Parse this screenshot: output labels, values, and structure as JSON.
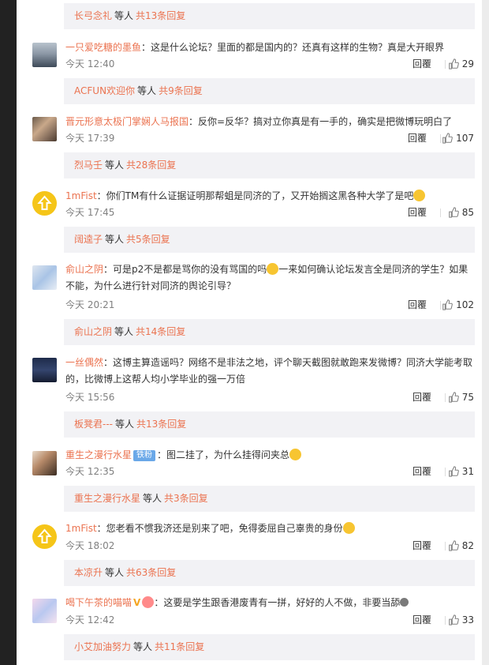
{
  "reply_bars": [
    {
      "name": "长弓念礼",
      "mid": "等人",
      "count": "共13条回复"
    },
    {
      "name": "ACFUN欢迎你",
      "mid": "等人",
      "count": "共9条回复"
    },
    {
      "name": "烈马壬",
      "mid": "等人",
      "count": "共28条回复"
    },
    {
      "name": "阔逵子",
      "mid": "等人",
      "count": "共5条回复"
    },
    {
      "name": "俞山之阴",
      "mid": "等人",
      "count": "共14条回复"
    },
    {
      "name": "板凳君---",
      "mid": "等人",
      "count": "共13条回复"
    },
    {
      "name": "重生之漫行水星",
      "mid": "等人",
      "count": "共3条回复"
    },
    {
      "name": "本凉升",
      "mid": "等人",
      "count": "共63条回复"
    },
    {
      "name": "小艾加油努力",
      "mid": "等人",
      "count": "共11条回复"
    }
  ],
  "comments": [
    {
      "user": "一只爱吃糖的墨鱼",
      "text": "：这是什么论坛？里面的都是国内的？还真有这样的生物？真是大开眼界",
      "time": "今天 12:40",
      "reply": "回覆",
      "likes": "29"
    },
    {
      "user": "晋元形意太极门掌娴人马报国",
      "text": "：反你=反华？搞对立你真是有一手的，确实是把微博玩明白了",
      "time": "今天 17:39",
      "reply": "回覆",
      "likes": "107"
    },
    {
      "user": "1mFist",
      "text": "：你们TM有什么证据证明那帮蛆是同济的了，又开始搁这黑各种大学了是吧",
      "time": "今天 17:45",
      "reply": "回覆",
      "likes": "85"
    },
    {
      "user": "俞山之阴",
      "text": "：可是p2不是都是骂你的没有骂国的吗",
      "text2": "一来如何确认论坛发言全是同济的学生？如果",
      "text3": "不能，为什么进行针对同济的舆论引导？",
      "time": "今天 20:21",
      "reply": "回覆",
      "likes": "102"
    },
    {
      "user": "一丝偶然",
      "text": "：这博主算造谣吗？网络不是非法之地，评个聊天截图就敢跑来发微博？同济大学能考取",
      "text2": "的，比微博上这帮人均小学毕业的强一万倍",
      "time": "今天 15:56",
      "reply": "回覆",
      "likes": "75"
    },
    {
      "user": "重生之漫行水星",
      "badge": "铁粉",
      "text": "：图二挂了，为什么挂得问夹总",
      "time": "今天 12:35",
      "reply": "回覆",
      "likes": "31"
    },
    {
      "user": "1mFist",
      "text": "：您老看不惯我济还是别来了吧，免得委屈自己辜贵的身份",
      "time": "今天 18:02",
      "reply": "回覆",
      "likes": "82"
    },
    {
      "user": "喝下午茶的喵喵",
      "text": "：这要是学生跟香港废青有一拼，好好的人不做，非要当舔",
      "time": "今天 12:42",
      "reply": "回覆",
      "likes": "33"
    }
  ],
  "icons": {
    "like": "thumbs-up-icon",
    "vip": "v-icon",
    "emoji": "emoji-icon"
  },
  "colors": {
    "username": "#eb7350",
    "reply_bar_bg": "#f2f2f5",
    "meta_gray": "#808080"
  }
}
